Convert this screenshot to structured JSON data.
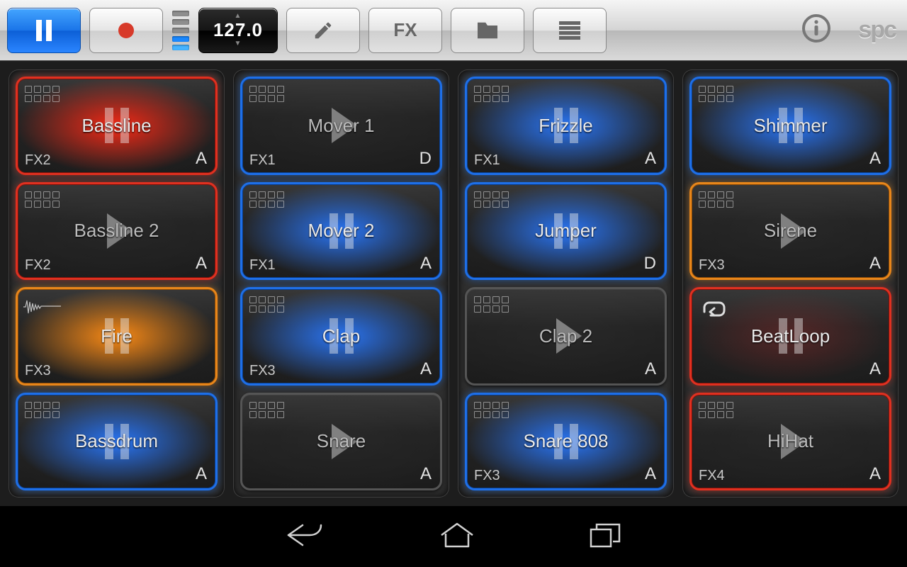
{
  "toolbar": {
    "bpm": "127.0",
    "fx_label": "FX",
    "logo": "spc"
  },
  "columns": [
    [
      {
        "name": "Bassline",
        "fx": "FX2",
        "group": "A",
        "border": "red",
        "glow": "red",
        "state": "pause",
        "corner": "steps"
      },
      {
        "name": "Bassline 2",
        "fx": "FX2",
        "group": "A",
        "border": "red",
        "glow": "",
        "state": "play",
        "corner": "steps",
        "dim": true
      },
      {
        "name": "Fire",
        "fx": "FX3",
        "group": "",
        "border": "orange",
        "glow": "orange",
        "state": "pause",
        "corner": "wave"
      },
      {
        "name": "Bassdrum",
        "fx": "",
        "group": "A",
        "border": "blue",
        "glow": "blue",
        "state": "pause",
        "corner": "steps"
      }
    ],
    [
      {
        "name": "Mover 1",
        "fx": "FX1",
        "group": "D",
        "border": "blue",
        "glow": "",
        "state": "play",
        "corner": "steps",
        "dim": true
      },
      {
        "name": "Mover 2",
        "fx": "FX1",
        "group": "A",
        "border": "blue",
        "glow": "blue",
        "state": "pause",
        "corner": "steps"
      },
      {
        "name": "Clap",
        "fx": "FX3",
        "group": "A",
        "border": "blue",
        "glow": "blue",
        "state": "pause",
        "corner": "steps"
      },
      {
        "name": "Snare",
        "fx": "",
        "group": "A",
        "border": "grey",
        "glow": "",
        "state": "play",
        "corner": "steps",
        "dim": true
      }
    ],
    [
      {
        "name": "Frizzle",
        "fx": "FX1",
        "group": "A",
        "border": "blue",
        "glow": "blue",
        "state": "pause",
        "corner": "steps"
      },
      {
        "name": "Jumper",
        "fx": "",
        "group": "D",
        "border": "blue",
        "glow": "blue",
        "state": "pause",
        "corner": "steps"
      },
      {
        "name": "Clap 2",
        "fx": "",
        "group": "A",
        "border": "grey",
        "glow": "",
        "state": "play",
        "corner": "steps",
        "dim": true
      },
      {
        "name": "Snare 808",
        "fx": "FX3",
        "group": "A",
        "border": "blue",
        "glow": "blue",
        "state": "pause",
        "corner": "steps"
      }
    ],
    [
      {
        "name": "Shimmer",
        "fx": "",
        "group": "A",
        "border": "blue",
        "glow": "blue",
        "state": "pause",
        "corner": "steps"
      },
      {
        "name": "Sirene",
        "fx": "FX3",
        "group": "A",
        "border": "orange",
        "glow": "",
        "state": "play",
        "corner": "steps",
        "dim": true
      },
      {
        "name": "BeatLoop",
        "fx": "",
        "group": "A",
        "border": "red",
        "glow": "dimred",
        "state": "pause",
        "corner": "loop"
      },
      {
        "name": "HiHat",
        "fx": "FX4",
        "group": "A",
        "border": "red",
        "glow": "",
        "state": "play",
        "corner": "steps",
        "dim": true
      }
    ]
  ]
}
